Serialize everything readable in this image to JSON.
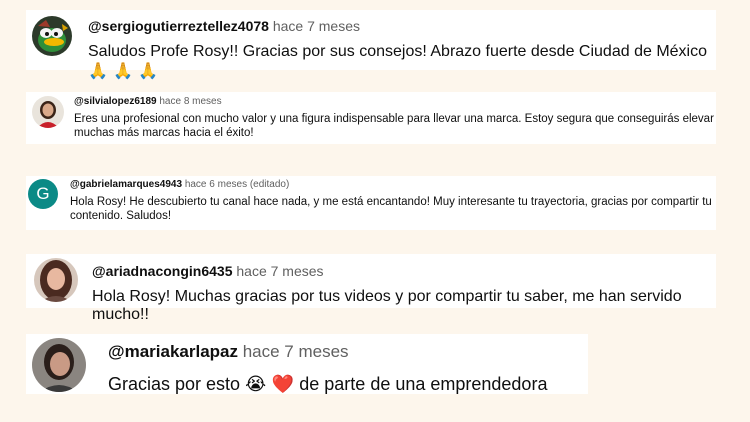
{
  "comments": [
    {
      "handle": "@sergiogutierreztellez4078",
      "time": "hace 7 meses",
      "text": "Saludos Profe Rosy!! Gracias por sus consejos! Abrazo fuerte desde Ciudad de México",
      "emoji": "🙏 🙏 🙏",
      "avatar": "cartoon-duck-avatar"
    },
    {
      "handle": "@silvialopez6189",
      "time": "hace 8 meses",
      "text": "Eres una profesional con mucho valor y una figura indispensable para llevar una marca. Estoy segura que conseguirás elevar muchas más marcas hacia el éxito!",
      "avatar": "profile-photo-avatar"
    },
    {
      "handle": "@gabrielamarques4943",
      "time": "hace 6 meses (editado)",
      "text": "Hola Rosy! He descubierto tu canal hace nada, y me está encantando! Muy interesante tu trayectoria, gracias por compartir tu contenido. Saludos!",
      "avatar_letter": "G",
      "avatar_color": "#0b8a86"
    },
    {
      "handle": "@ariadnacongin6435",
      "time": "hace 7 meses",
      "text": "Hola Rosy! Muchas gracias por tus videos y por compartir tu saber, me han servido mucho!!",
      "avatar": "profile-photo-avatar"
    },
    {
      "handle": "@mariakarlapaz",
      "time": "hace 7 meses",
      "text_before": "Gracias por esto",
      "emoji": "😭 ❤️",
      "text_after": "de parte de una emprendedora",
      "avatar": "profile-photo-avatar"
    }
  ],
  "colors": {
    "page_background": "#fdf6ec",
    "card_background": "#ffffff",
    "handle": "#0f0f0f",
    "time": "#606060"
  }
}
